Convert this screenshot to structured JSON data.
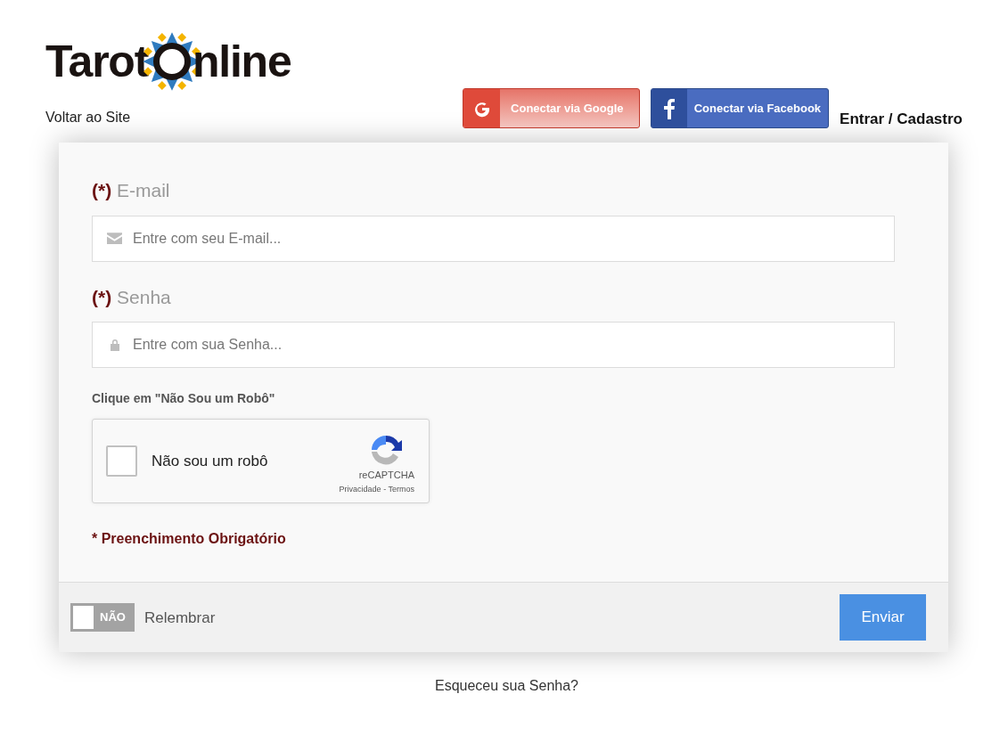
{
  "logo": {
    "word_1": "Tarot",
    "word_2": "nline"
  },
  "header": {
    "back_link": "Voltar ao Site",
    "google_button": "Conectar via Google",
    "facebook_button": "Conectar via Facebook",
    "login_link": "Entrar / Cadastro"
  },
  "form": {
    "fields": [
      {
        "required_mark": "(*)",
        "label": "E-mail",
        "placeholder": "Entre com seu E-mail...",
        "kind": "email"
      },
      {
        "required_mark": "(*)",
        "label": "Senha",
        "placeholder": "Entre com sua Senha...",
        "kind": "password"
      }
    ],
    "captcha_prompt": "Clique em \"Não Sou um Robô\"",
    "captcha": {
      "checked": false,
      "label": "Não sou um robô",
      "brand": "reCAPTCHA",
      "privacy": "Privacidade",
      "separator": "-",
      "terms": "Termos"
    },
    "required_note": "* Preenchimento Obrigatório"
  },
  "footer": {
    "remember_toggle": {
      "on": false,
      "state_label": "NÃO"
    },
    "remember_label": "Relembrar",
    "submit": "Enviar"
  },
  "forgot_link": "Esqueceu sua Senha?"
}
